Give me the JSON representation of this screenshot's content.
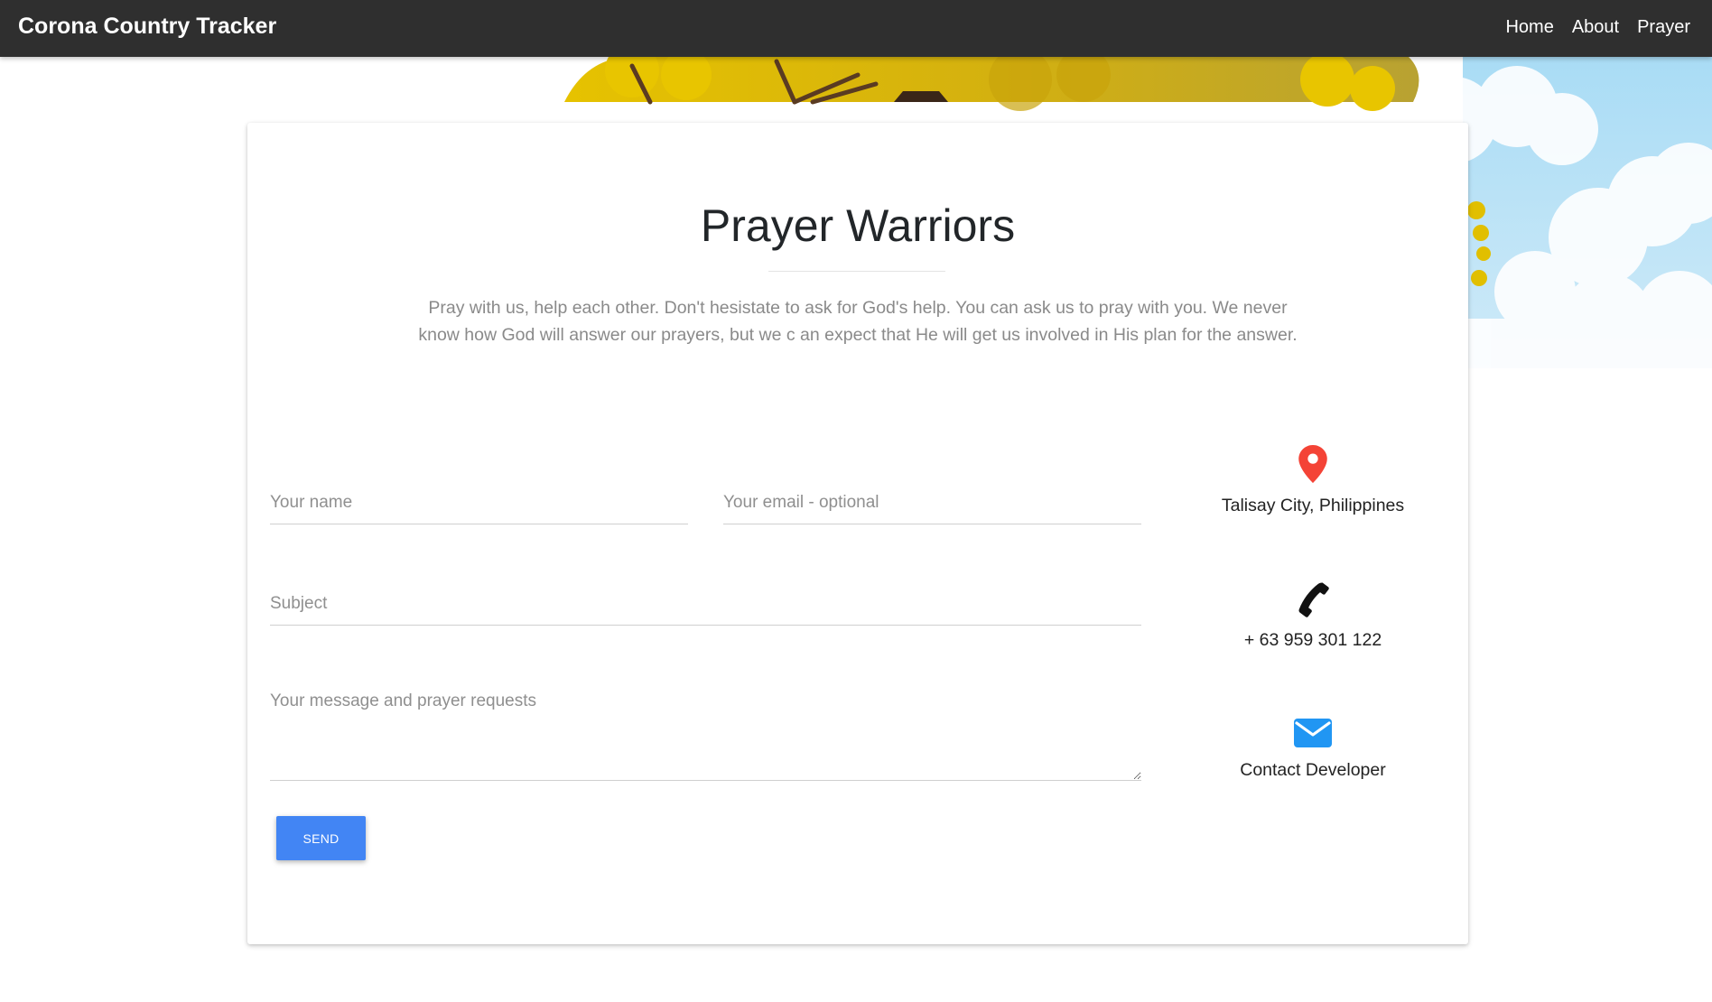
{
  "navbar": {
    "brand": "Corona Country Tracker",
    "links": [
      "Home",
      "About",
      "Prayer"
    ]
  },
  "main": {
    "title": "Prayer Warriors",
    "intro": "Pray with us, help each other. Don't hesistate to ask for God's help. You can ask us to pray with you. We never know how God will answer our prayers, but we c an expect that He will get us involved in His plan for the answer."
  },
  "form": {
    "name_placeholder": "Your name",
    "email_placeholder": "Your email - optional",
    "subject_placeholder": "Subject",
    "message_placeholder": "Your message and prayer requests",
    "send_label": "SEND"
  },
  "contact": {
    "location": "Talisay City, Philippines",
    "phone": "+ 63 959 301 122",
    "email_label": "Contact Developer"
  },
  "icons": {
    "location": "map-marker-icon",
    "phone": "phone-icon",
    "email": "envelope-icon"
  },
  "colors": {
    "navbar": "#2f2f2f",
    "accent": "#4285f4",
    "marker": "#f44336",
    "mail": "#2196f3"
  }
}
